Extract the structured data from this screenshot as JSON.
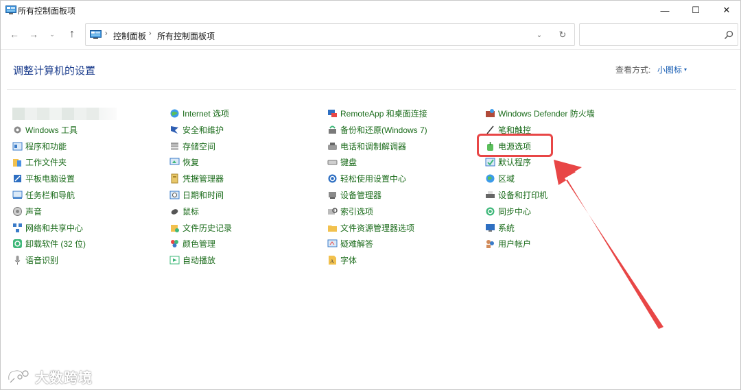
{
  "window": {
    "title": "所有控制面板项",
    "controls": {
      "minimize": "—",
      "maximize": "☐",
      "close": "✕"
    }
  },
  "address_bar": {
    "segments": [
      "控制面板",
      "所有控制面板项"
    ],
    "separator": "›",
    "search_placeholder": ""
  },
  "header": {
    "title": "调整计算机的设置",
    "view_by_label": "查看方式:",
    "view_mode": "小图标"
  },
  "columns": [
    {
      "items": [
        {
          "label": "",
          "icon": "blurred-icon",
          "blurred": true
        },
        {
          "label": "Windows 工具",
          "icon": "gear-icon"
        },
        {
          "label": "程序和功能",
          "icon": "programs-icon"
        },
        {
          "label": "工作文件夹",
          "icon": "folder-icon"
        },
        {
          "label": "平板电脑设置",
          "icon": "tablet-icon"
        },
        {
          "label": "任务栏和导航",
          "icon": "taskbar-icon"
        },
        {
          "label": "声音",
          "icon": "speaker-icon"
        },
        {
          "label": "网络和共享中心",
          "icon": "network-icon"
        },
        {
          "label": "卸载软件 (32 位)",
          "icon": "uninstall-icon"
        },
        {
          "label": "语音识别",
          "icon": "microphone-icon"
        }
      ]
    },
    {
      "items": [
        {
          "label": "Internet 选项",
          "icon": "globe-icon"
        },
        {
          "label": "安全和维护",
          "icon": "flag-icon"
        },
        {
          "label": "存储空间",
          "icon": "storage-icon"
        },
        {
          "label": "恢复",
          "icon": "recovery-icon"
        },
        {
          "label": "凭据管理器",
          "icon": "credential-icon"
        },
        {
          "label": "日期和时间",
          "icon": "clock-icon"
        },
        {
          "label": "鼠标",
          "icon": "mouse-icon"
        },
        {
          "label": "文件历史记录",
          "icon": "file-history-icon"
        },
        {
          "label": "颜色管理",
          "icon": "color-icon"
        },
        {
          "label": "自动播放",
          "icon": "autoplay-icon"
        }
      ]
    },
    {
      "items": [
        {
          "label": "RemoteApp 和桌面连接",
          "icon": "remote-icon"
        },
        {
          "label": "备份和还原(Windows 7)",
          "icon": "backup-icon"
        },
        {
          "label": "电话和调制解调器",
          "icon": "phone-icon"
        },
        {
          "label": "键盘",
          "icon": "keyboard-icon"
        },
        {
          "label": "轻松使用设置中心",
          "icon": "accessibility-icon"
        },
        {
          "label": "设备管理器",
          "icon": "device-manager-icon"
        },
        {
          "label": "索引选项",
          "icon": "index-icon"
        },
        {
          "label": "文件资源管理器选项",
          "icon": "folder-options-icon"
        },
        {
          "label": "疑难解答",
          "icon": "troubleshoot-icon"
        },
        {
          "label": "字体",
          "icon": "font-icon"
        }
      ]
    },
    {
      "items": [
        {
          "label": "Windows Defender 防火墙",
          "icon": "firewall-icon"
        },
        {
          "label": "笔和触控",
          "icon": "pen-icon"
        },
        {
          "label": "电源选项",
          "icon": "power-icon",
          "highlighted": true
        },
        {
          "label": "默认程序",
          "icon": "default-programs-icon"
        },
        {
          "label": "区域",
          "icon": "region-icon"
        },
        {
          "label": "设备和打印机",
          "icon": "printer-icon"
        },
        {
          "label": "同步中心",
          "icon": "sync-icon"
        },
        {
          "label": "系统",
          "icon": "system-icon"
        },
        {
          "label": "用户帐户",
          "icon": "users-icon"
        }
      ]
    }
  ],
  "colors": {
    "link": "#1a6b1a",
    "heading": "#1e3f8e",
    "view_mode": "#1a5fb4",
    "annotation": "#e84646"
  },
  "watermark": {
    "text": "大数跨境"
  }
}
